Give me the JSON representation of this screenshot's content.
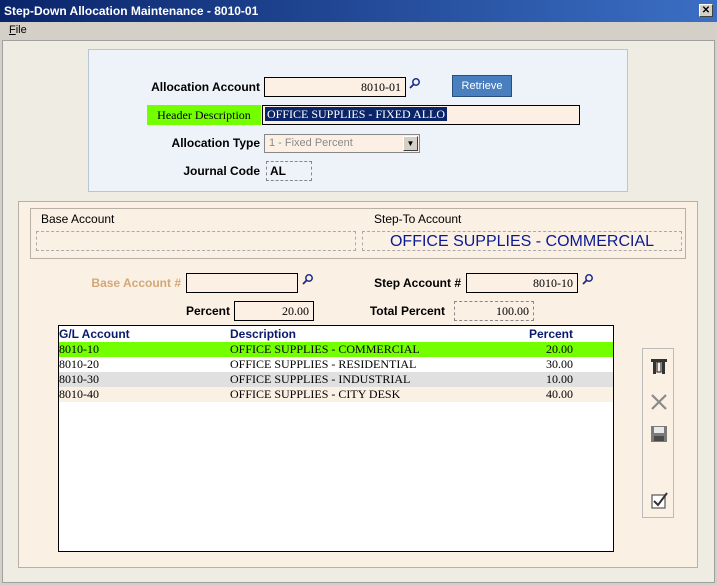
{
  "window": {
    "title": "Step-Down Allocation Maintenance - 8010-01",
    "close_glyph": "✕"
  },
  "menu": {
    "file_label": "File",
    "file_mnemonic": "F",
    "file_rest": "ile"
  },
  "header": {
    "allocation_account_label": "Allocation Account",
    "allocation_account_value": "8010-01",
    "retrieve_label": "Retrieve",
    "header_description_label": "Header Description",
    "header_description_value": "OFFICE SUPPLIES - FIXED ALLO",
    "allocation_type_label": "Allocation Type",
    "allocation_type_value": "1 - Fixed Percent",
    "journal_code_label": "Journal Code",
    "journal_code_value": "AL"
  },
  "accounts": {
    "base_account_caption": "Base Account",
    "base_account_value": "",
    "step_to_caption": "Step-To Account",
    "step_to_value": "OFFICE SUPPLIES - COMMERCIAL"
  },
  "entry": {
    "base_account_num_label": "Base Account #",
    "base_account_num_value": "",
    "step_account_label": "Step Account #",
    "step_account_value": "8010-10",
    "percent_label": "Percent",
    "percent_value": "20.00",
    "total_percent_label": "Total Percent",
    "total_percent_value": "100.00"
  },
  "grid": {
    "columns": [
      "G/L Account",
      "Description",
      "Percent"
    ],
    "rows": [
      {
        "account": "8010-10",
        "description": "OFFICE SUPPLIES - COMMERCIAL",
        "percent": "20.00",
        "bg": "#73ff00"
      },
      {
        "account": "8010-20",
        "description": "OFFICE SUPPLIES - RESIDENTIAL",
        "percent": "30.00",
        "bg": "#ffffff"
      },
      {
        "account": "8010-30",
        "description": "OFFICE SUPPLIES - INDUSTRIAL",
        "percent": "10.00",
        "bg": "#e0e0e0"
      },
      {
        "account": "8010-40",
        "description": "OFFICE SUPPLIES - CITY DESK",
        "percent": "40.00",
        "bg": "#fbf0e4"
      }
    ]
  },
  "toolbar": {
    "icons": [
      "tools-icon",
      "delete-icon",
      "save-icon",
      "checkbox-icon"
    ]
  },
  "colors": {
    "accent_green": "#73ff00",
    "title_blue": "#0a246a",
    "step_to_text": "#0a1a90"
  }
}
